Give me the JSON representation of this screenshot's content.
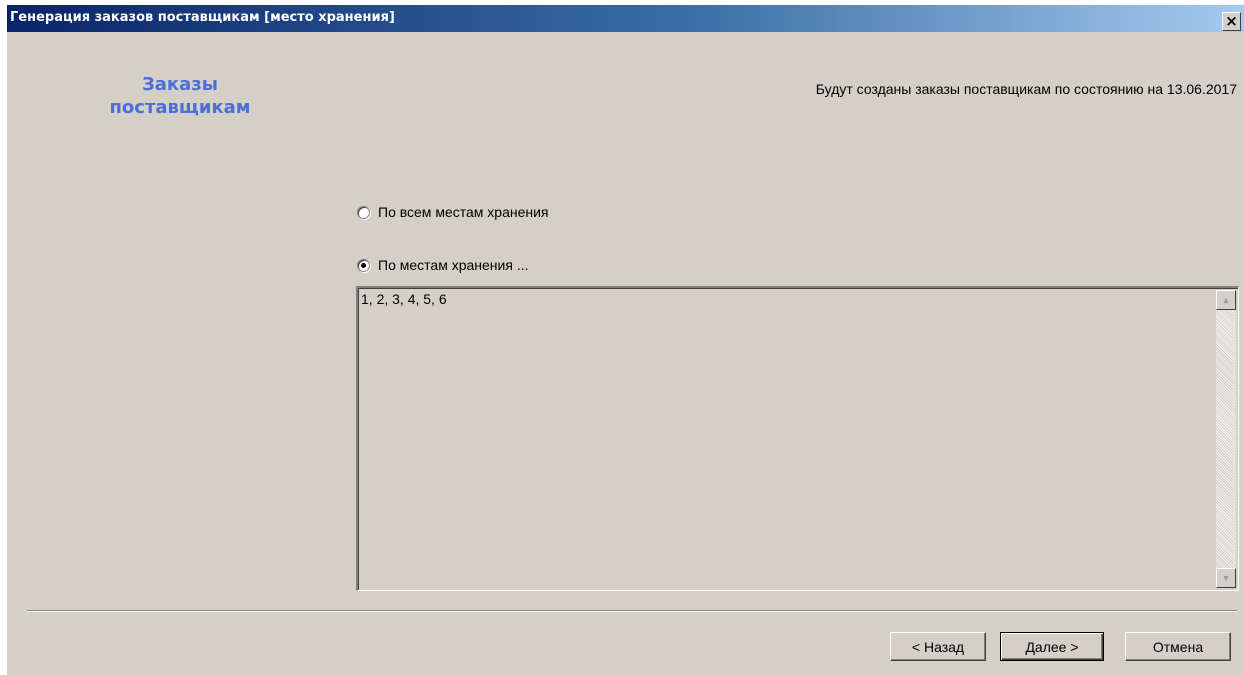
{
  "window": {
    "title": "Генерация заказов поставщикам [место хранения]",
    "close_symbol": "×"
  },
  "heading": {
    "line1": "Заказы",
    "line2": "поставщикам",
    "color": "#4b6ed8"
  },
  "status_text": "Будут созданы заказы поставщикам по состоянию на 13.06.2017",
  "options": {
    "all_locations": {
      "label": "По всем местам хранения",
      "checked": false
    },
    "selected_locations": {
      "label": "По местам хранения ...",
      "checked": true
    }
  },
  "locations_field": {
    "value": "1, 2, 3, 4, 5, 6"
  },
  "scrollbar": {
    "up_icon": "scroll-up-arrow",
    "down_icon": "scroll-down-arrow",
    "up_glyph": "▲",
    "down_glyph": "▼"
  },
  "buttons": {
    "back": "< Назад",
    "next": "Далее >",
    "cancel": "Отмена"
  }
}
